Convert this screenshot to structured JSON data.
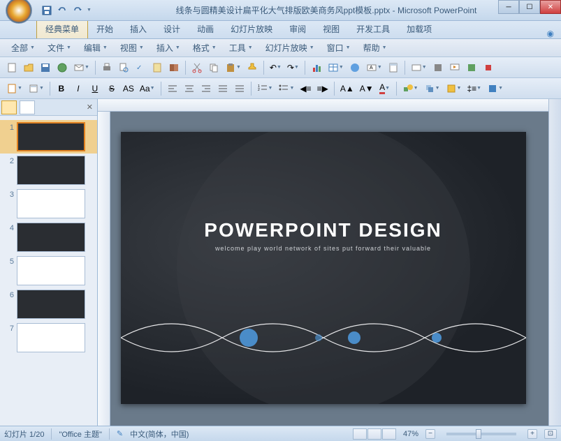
{
  "title": "线条与圆精美设计扁平化大气排版欧美商务风ppt模板.pptx - Microsoft PowerPoint",
  "ribbon": {
    "tabs": [
      "经典菜单",
      "开始",
      "插入",
      "设计",
      "动画",
      "幻灯片放映",
      "审阅",
      "视图",
      "开发工具",
      "加载项"
    ],
    "active": 0
  },
  "classic_menu": [
    "全部",
    "文件",
    "编辑",
    "视图",
    "插入",
    "格式",
    "工具",
    "幻灯片放映",
    "窗口",
    "帮助"
  ],
  "thumbs": {
    "count": 7,
    "active": 1,
    "items": [
      {
        "n": 1,
        "dark": true
      },
      {
        "n": 2,
        "dark": true
      },
      {
        "n": 3,
        "dark": false
      },
      {
        "n": 4,
        "dark": true
      },
      {
        "n": 5,
        "dark": false
      },
      {
        "n": 6,
        "dark": true
      },
      {
        "n": 7,
        "dark": false
      }
    ]
  },
  "slide": {
    "title": "POWERPOINT  DESIGN",
    "subtitle": "welcome  play  world  network  of  sites  put  forward  their  valuable"
  },
  "status": {
    "slide_indicator": "幻灯片 1/20",
    "theme": "\"Office 主题\"",
    "language": "中文(简体，中国)",
    "zoom": "47%"
  }
}
